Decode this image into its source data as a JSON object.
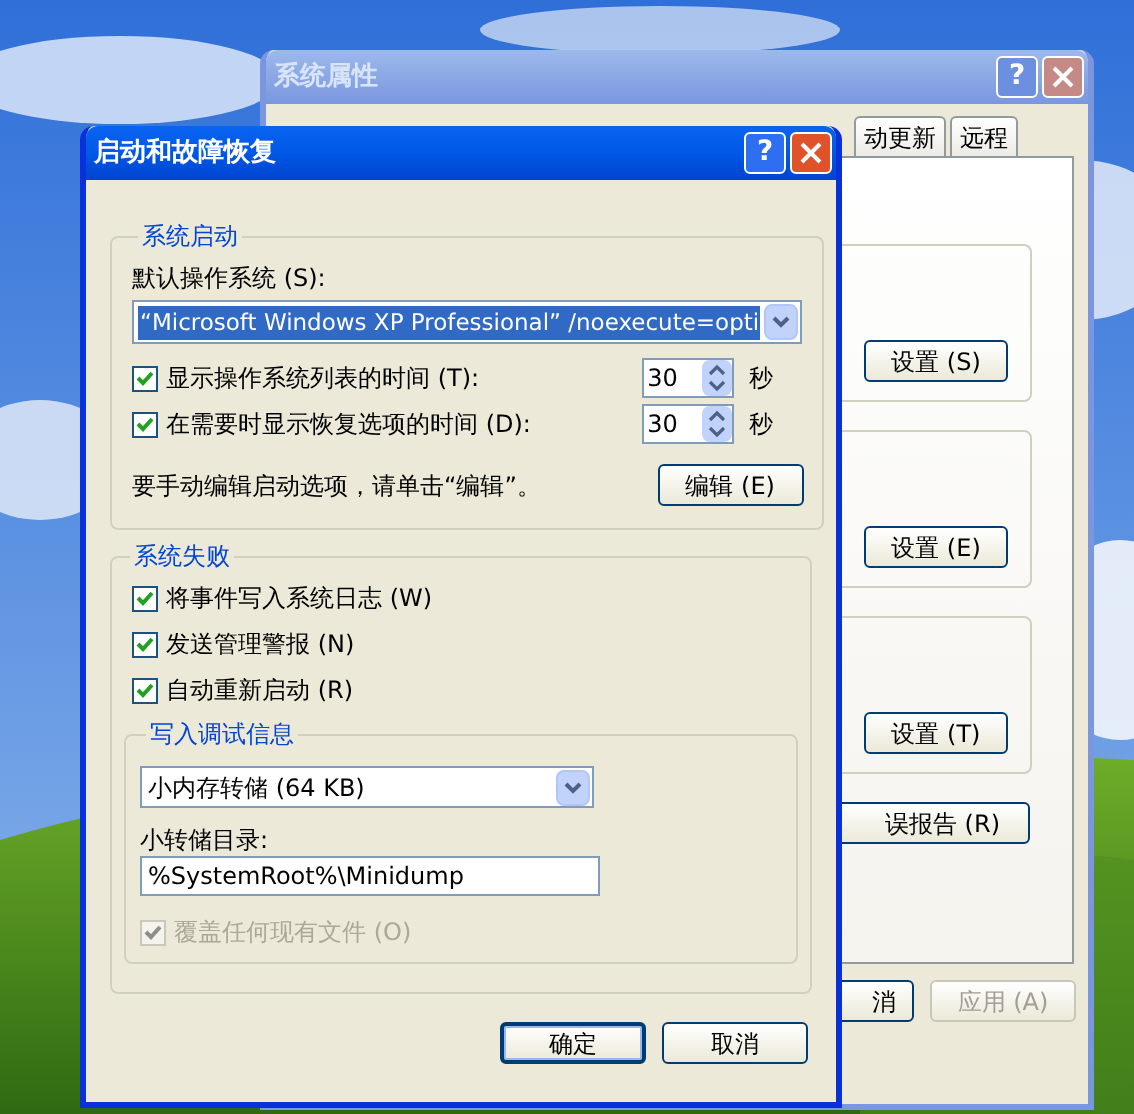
{
  "back_window": {
    "title": "系统属性",
    "active": false,
    "help": "?",
    "tabs": [
      {
        "label": "动更新",
        "selected": false
      },
      {
        "label": "远程",
        "selected": false
      }
    ],
    "group_buttons": [
      "设置 (S)",
      "设置 (E)",
      "设置 (T)"
    ],
    "report_button": "误报告 (R)",
    "buttons": [
      {
        "label": "消",
        "disabled": false
      },
      {
        "label": "应用 (A)",
        "disabled": true
      }
    ]
  },
  "dialog": {
    "title": "启动和故障恢复",
    "help": "?",
    "startup": {
      "legend": "系统启动",
      "default_os_label": "默认操作系统 (S):",
      "default_os": "“Microsoft Windows XP Professional” /noexecute=opti",
      "timers": [
        {
          "label": "显示操作系统列表的时间 (T):",
          "checked": true,
          "value": "30",
          "unit": "秒"
        },
        {
          "label": "在需要时显示恢复选项的时间 (D):",
          "checked": true,
          "value": "30",
          "unit": "秒"
        }
      ],
      "edit_hint": "要手动编辑启动选项，请单击“编辑”。",
      "edit_button": "编辑 (E)"
    },
    "failure": {
      "legend": "系统失败",
      "options": [
        {
          "label": "将事件写入系统日志 (W)",
          "checked": true
        },
        {
          "label": "发送管理警报 (N)",
          "checked": true
        },
        {
          "label": "自动重新启动 (R)",
          "checked": true
        }
      ],
      "debug": {
        "legend": "写入调试信息",
        "dump_type": "小内存转储 (64 KB)",
        "dir_label": "小转储目录:",
        "dir": "%SystemRoot%\\Minidump",
        "overwrite": {
          "label": "覆盖任何现有文件 (O)",
          "checked": true,
          "disabled": true
        }
      }
    },
    "buttons": [
      {
        "label": "确定",
        "default": true
      },
      {
        "label": "取消",
        "default": false
      }
    ]
  }
}
